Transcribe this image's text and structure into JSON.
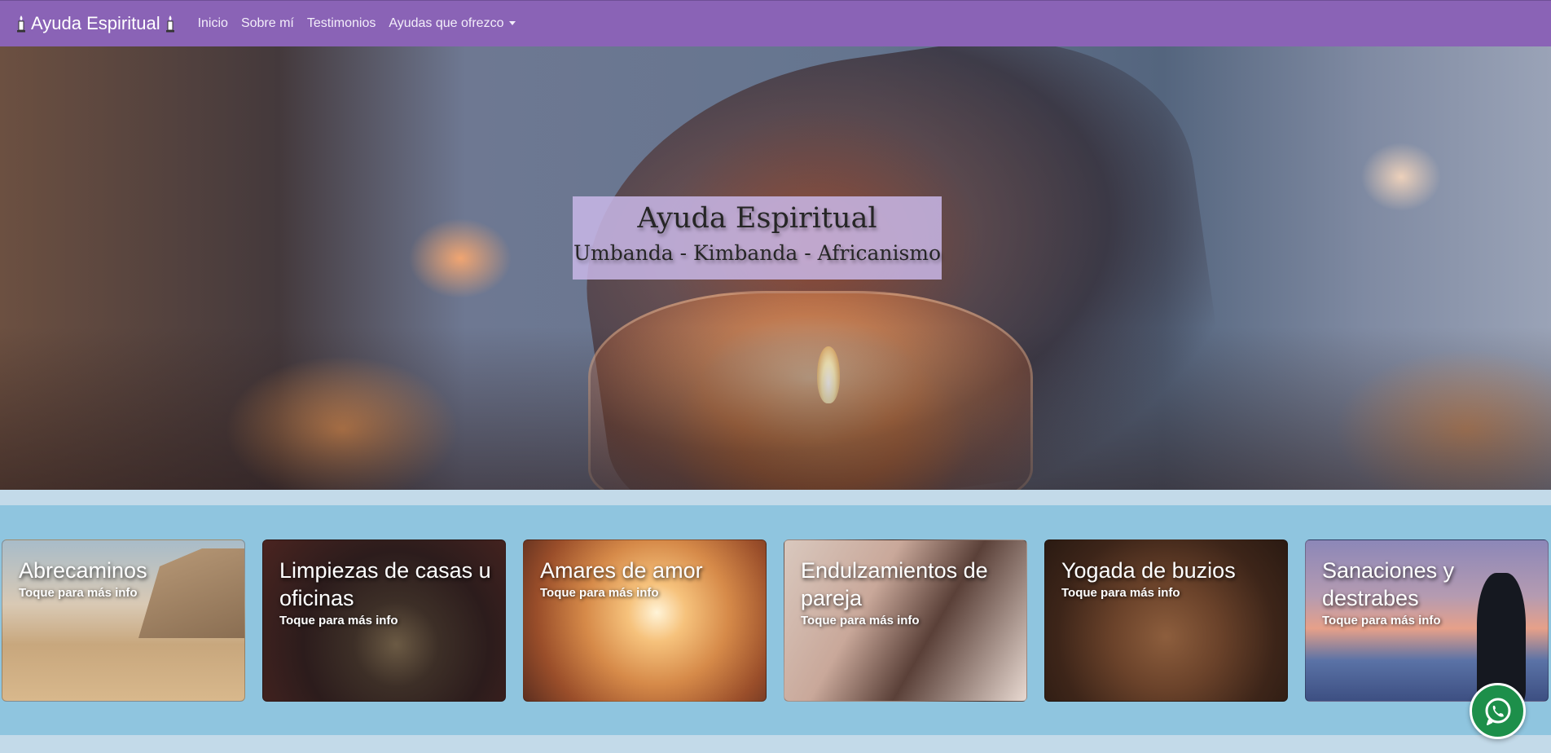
{
  "navbar": {
    "brand": "Ayuda Espiritual",
    "brand_icon": "candle-icon",
    "links": [
      "Inicio",
      "Sobre mí",
      "Testimonios"
    ],
    "dropdown": "Ayudas que ofrezco"
  },
  "hero": {
    "title": "Ayuda Espiritual",
    "subtitle": "Umbanda - Kimbanda - Africanismo"
  },
  "services": [
    {
      "title": "Abrecaminos",
      "hint": "Toque para más info"
    },
    {
      "title": "Limpiezas de casas u oficinas",
      "hint": "Toque para más info"
    },
    {
      "title": "Amares de amor",
      "hint": "Toque para más info"
    },
    {
      "title": "Endulzamientos de pareja",
      "hint": "Toque para más info"
    },
    {
      "title": "Yogada de buzios",
      "hint": "Toque para más info"
    },
    {
      "title": "Sanaciones y destrabes",
      "hint": "Toque para más info"
    }
  ],
  "floating": {
    "icon": "whatsapp-icon"
  },
  "colors": {
    "navbar": "#8a63b6",
    "services_bg": "#8fc5df",
    "hero_box": "#c9b7e7",
    "whatsapp": "#1d8f4a"
  }
}
